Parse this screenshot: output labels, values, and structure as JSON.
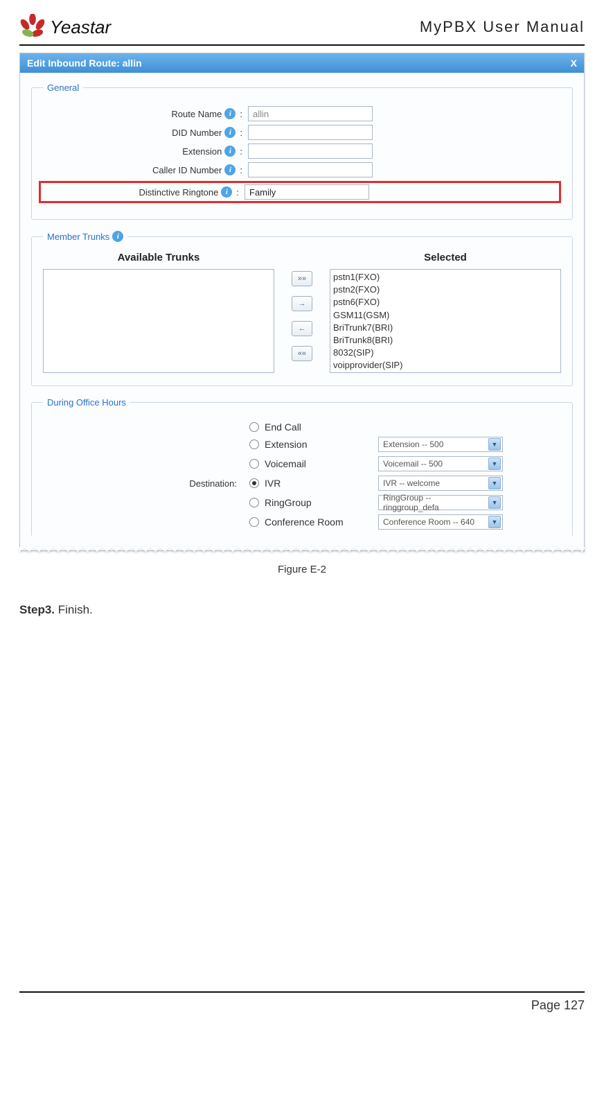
{
  "header": {
    "brand": "Yeastar",
    "doc_title": "MyPBX  User  Manual"
  },
  "dialog": {
    "title": "Edit Inbound Route: allin",
    "close": "X"
  },
  "general": {
    "legend": "General",
    "route_name_label": "Route Name",
    "route_name_value": "allin",
    "did_label": "DID Number",
    "did_value": "",
    "ext_label": "Extension",
    "ext_value": "",
    "cid_label": "Caller ID Number",
    "cid_value": "",
    "ring_label": "Distinctive Ringtone",
    "ring_value": "Family"
  },
  "trunks": {
    "legend": "Member Trunks",
    "available_title": "Available Trunks",
    "selected_title": "Selected",
    "btn_all_right": "»»",
    "btn_right": "→",
    "btn_left": "←",
    "btn_all_left": "««",
    "selected_items": {
      "0": "pstn1(FXO)",
      "1": "pstn2(FXO)",
      "2": "pstn6(FXO)",
      "3": "GSM11(GSM)",
      "4": "BriTrunk7(BRI)",
      "5": "BriTrunk8(BRI)",
      "6": "8032(SIP)",
      "7": "voipprovider(SIP)"
    }
  },
  "office": {
    "legend": "During Office Hours",
    "dest_label": "Destination:",
    "opts": {
      "endcall": "End Call",
      "ext": "Extension",
      "vm": "Voicemail",
      "ivr": "IVR",
      "rg": "RingGroup",
      "conf": "Conference Room"
    },
    "selects": {
      "ext": "Extension -- 500",
      "vm": "Voicemail -- 500",
      "ivr": "IVR -- welcome",
      "rg": "RingGroup -- ringgroup_defa",
      "conf": "Conference Room -- 640"
    }
  },
  "caption": "Figure E-2",
  "step": {
    "bold": "Step3.",
    "rest": " Finish."
  },
  "footer": "Page 127"
}
